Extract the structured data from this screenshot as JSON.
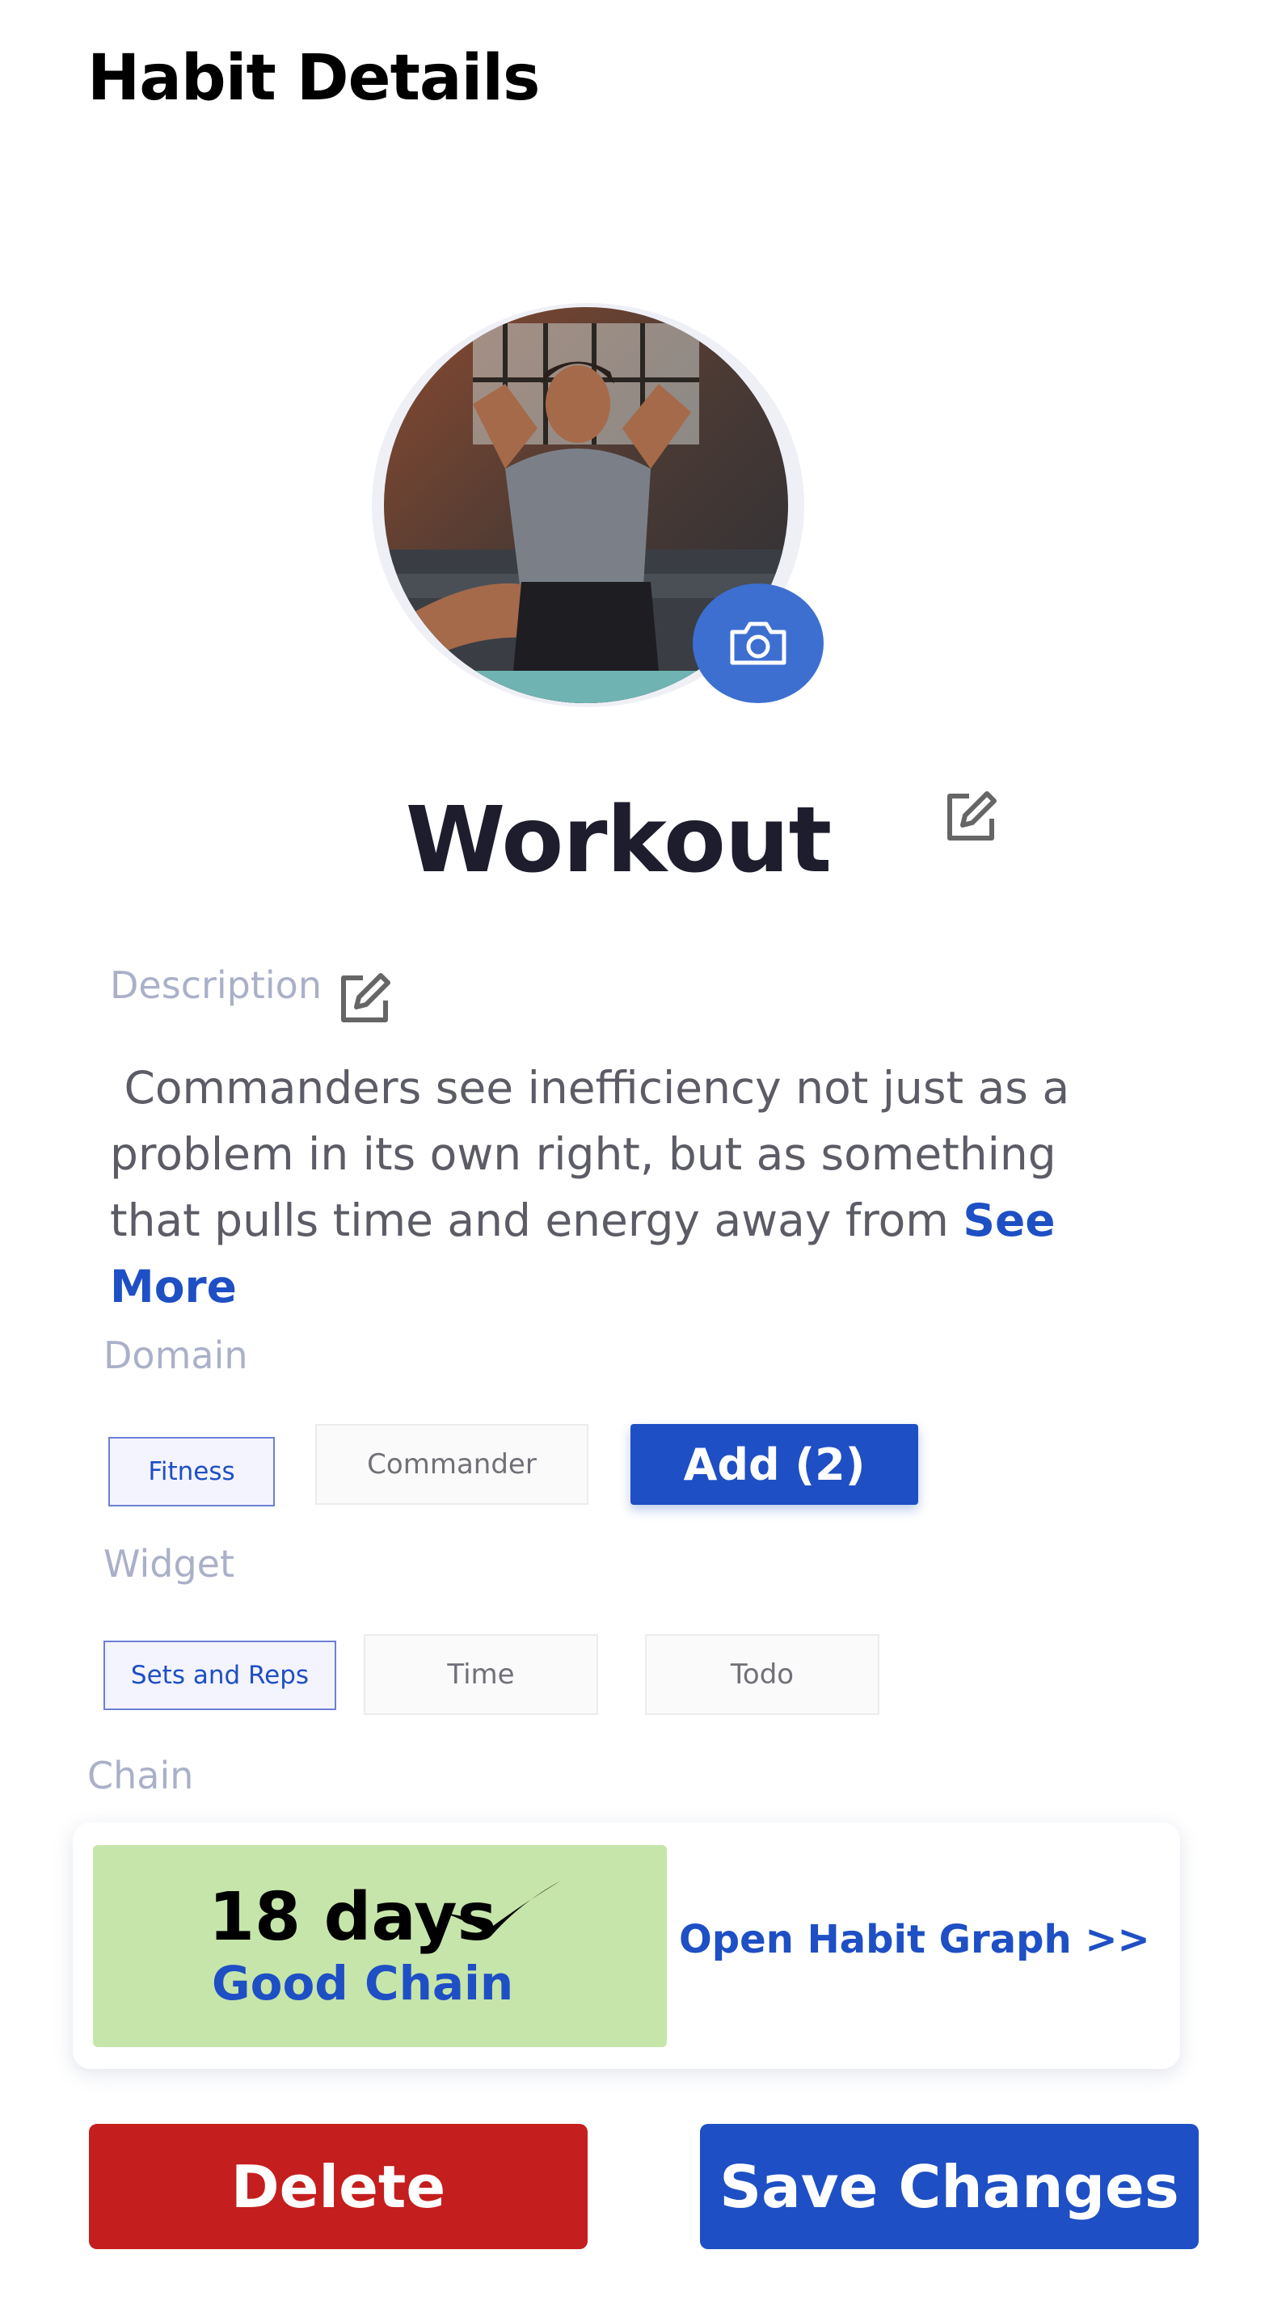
{
  "header": {
    "title": "Habit Details"
  },
  "habit": {
    "name": "Workout",
    "photo_icon": "camera-icon",
    "edit_icon": "edit-icon"
  },
  "description": {
    "label": "Description",
    "text": " Commanders see inefficiency not just as a problem in its own right, but as something that pulls time and energy away from ",
    "see_more": "See More"
  },
  "domain": {
    "label": "Domain",
    "options": [
      {
        "label": "Fitness",
        "selected": true
      },
      {
        "label": "Commander",
        "selected": false
      }
    ],
    "add_label": "Add (2)"
  },
  "widget": {
    "label": "Widget",
    "options": [
      {
        "label": "Sets and Reps",
        "selected": true
      },
      {
        "label": "Time",
        "selected": false
      },
      {
        "label": "Todo",
        "selected": false
      }
    ]
  },
  "chain": {
    "label": "Chain",
    "days": "18 days",
    "status": "Good Chain",
    "graph_link": "Open Habit Graph >>",
    "box_color": "#c6e5aa"
  },
  "actions": {
    "delete_label": "Delete",
    "save_label": "Save Changes",
    "delete_color": "#c41e1e",
    "save_color": "#1e4fc4"
  }
}
